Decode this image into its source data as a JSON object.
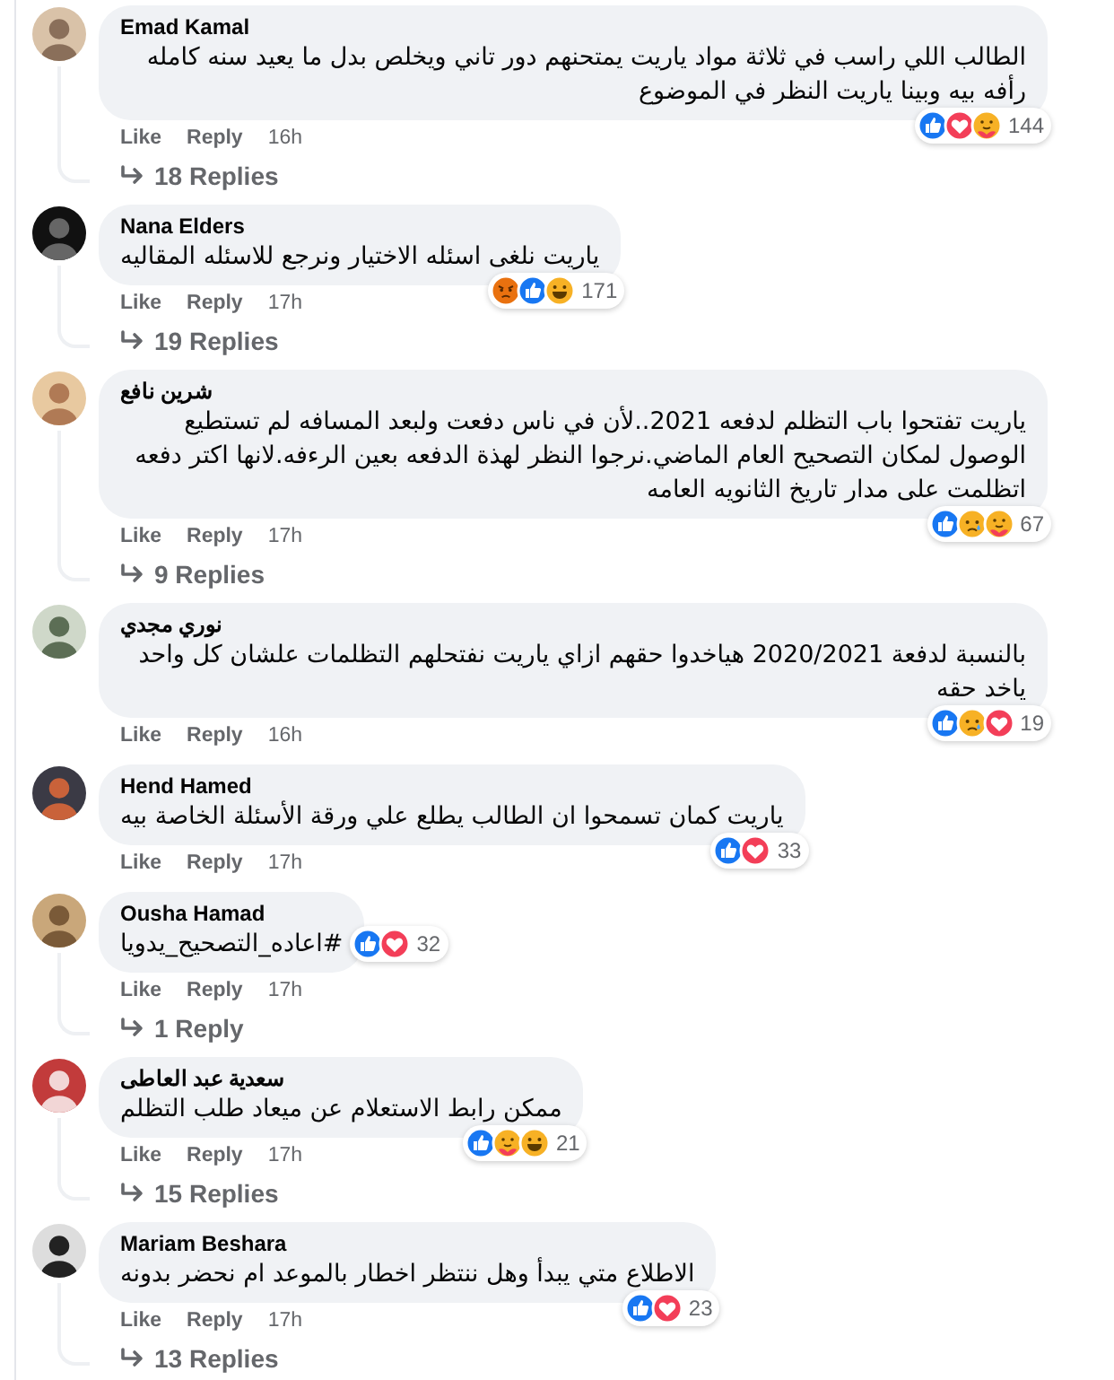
{
  "comments": [
    {
      "author": "Emad Kamal",
      "text": "الطالب اللي راسب في ثلاثة مواد ياريت يمتحنهم دور تاني ويخلص بدل ما يعيد سنه كامله رأفه بيه وبينا ياريت النظر في الموضوع",
      "reactions": [
        {
          "kind": "like"
        },
        {
          "kind": "love"
        },
        {
          "kind": "care"
        }
      ],
      "reaction_count": "144",
      "like": "Like",
      "reply": "Reply",
      "time": "16h",
      "replies": "18 Replies"
    },
    {
      "author": "Nana Elders",
      "text": "ياريت نلغى اسئله الاختيار ونرجع للاسئله المقاليه",
      "reactions": [
        {
          "kind": "angry"
        },
        {
          "kind": "like"
        },
        {
          "kind": "haha"
        }
      ],
      "reaction_count": "171",
      "like": "Like",
      "reply": "Reply",
      "time": "17h",
      "replies": "19 Replies"
    },
    {
      "author": "شرين نافع",
      "text": "ياريت تفتحوا باب التظلم لدفعه 2021..لأن في ناس دفعت ولبعد المسافه لم تستطيع الوصول لمكان التصحيح العام الماضي.نرجوا النظر لهذة الدفعه بعين الرءفه.لانها اكتر دفعه اتظلمت على مدار تاريخ الثانويه العامه",
      "reactions": [
        {
          "kind": "like"
        },
        {
          "kind": "sad"
        },
        {
          "kind": "care"
        }
      ],
      "reaction_count": "67",
      "like": "Like",
      "reply": "Reply",
      "time": "17h",
      "replies": "9 Replies"
    },
    {
      "author": "نوري مجدي",
      "text": "بالنسبة لدفعة 2020/2021 هياخدوا حقهم ازاي ياريت نفتحلهم التظلمات علشان كل واحد ياخد حقه",
      "reactions": [
        {
          "kind": "like"
        },
        {
          "kind": "sad"
        },
        {
          "kind": "love"
        }
      ],
      "reaction_count": "19",
      "like": "Like",
      "reply": "Reply",
      "time": "16h"
    },
    {
      "author": "Hend Hamed",
      "text": "ياريت كمان تسمحوا ان الطالب يطلع علي ورقة الأسئلة الخاصة بيه",
      "reactions": [
        {
          "kind": "like"
        },
        {
          "kind": "love"
        }
      ],
      "reaction_count": "33",
      "like": "Like",
      "reply": "Reply",
      "time": "17h"
    },
    {
      "author": "Ousha Hamad",
      "text": "#اعاده_التصحيح_يدويا",
      "reactions": [
        {
          "kind": "like"
        },
        {
          "kind": "love"
        }
      ],
      "reaction_count": "32",
      "like": "Like",
      "reply": "Reply",
      "time": "17h",
      "replies": "1 Reply"
    },
    {
      "author": "سعدية عبد العاطى",
      "text": "ممكن رابط الاستعلام عن ميعاد طلب التظلم",
      "reactions": [
        {
          "kind": "like"
        },
        {
          "kind": "care"
        },
        {
          "kind": "haha"
        }
      ],
      "reaction_count": "21",
      "like": "Like",
      "reply": "Reply",
      "time": "17h",
      "replies": "15 Replies"
    },
    {
      "author": "Mariam Beshara",
      "text": "الاطلاع متي يبدأ وهل ننتظر اخطار بالموعد ام نحضر بدونه",
      "reactions": [
        {
          "kind": "like"
        },
        {
          "kind": "love"
        }
      ],
      "reaction_count": "23",
      "like": "Like",
      "reply": "Reply",
      "time": "17h",
      "replies": "13 Replies"
    }
  ]
}
